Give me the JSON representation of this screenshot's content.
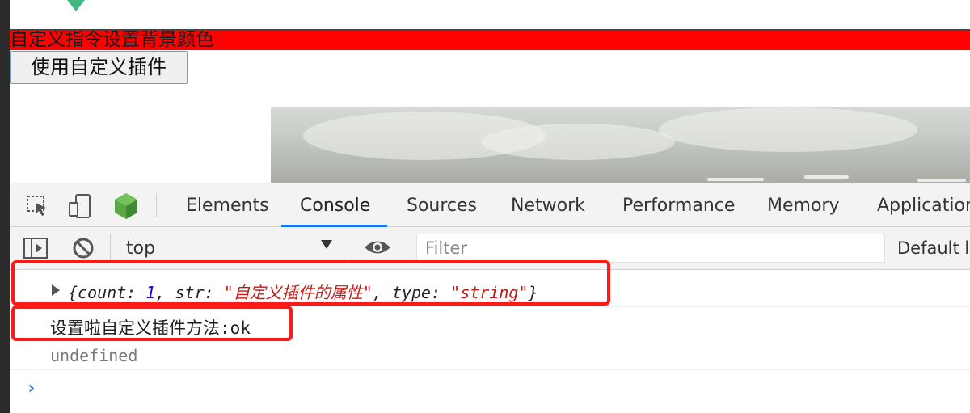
{
  "page": {
    "banner_text": "自定义指令设置背景颜色",
    "plugin_button_label": "使用自定义插件"
  },
  "devtools": {
    "tabs": [
      {
        "label": "Elements"
      },
      {
        "label": "Console",
        "active": true
      },
      {
        "label": "Sources"
      },
      {
        "label": "Network"
      },
      {
        "label": "Performance"
      },
      {
        "label": "Memory"
      },
      {
        "label": "Application"
      }
    ],
    "toolbar": {
      "context": "top",
      "filter_placeholder": "Filter",
      "levels_label": "Default l"
    },
    "console": {
      "object_log": {
        "open": "{",
        "count_key": "count",
        "count_value": "1",
        "str_key": "str",
        "str_value": "\"自定义插件的属性\"",
        "type_key": "type",
        "type_value": "\"string\"",
        "close": "}"
      },
      "log_text": "设置啦自定义插件方法:ok",
      "return_text": "undefined",
      "prompt_symbol": "›"
    }
  },
  "colors": {
    "banner_bg": "#ff0000",
    "active_tab_underline": "#1a73e8",
    "highlight_box": "#ff1a1a",
    "string_value": "#c41a16",
    "number_value": "#1c00cf"
  }
}
